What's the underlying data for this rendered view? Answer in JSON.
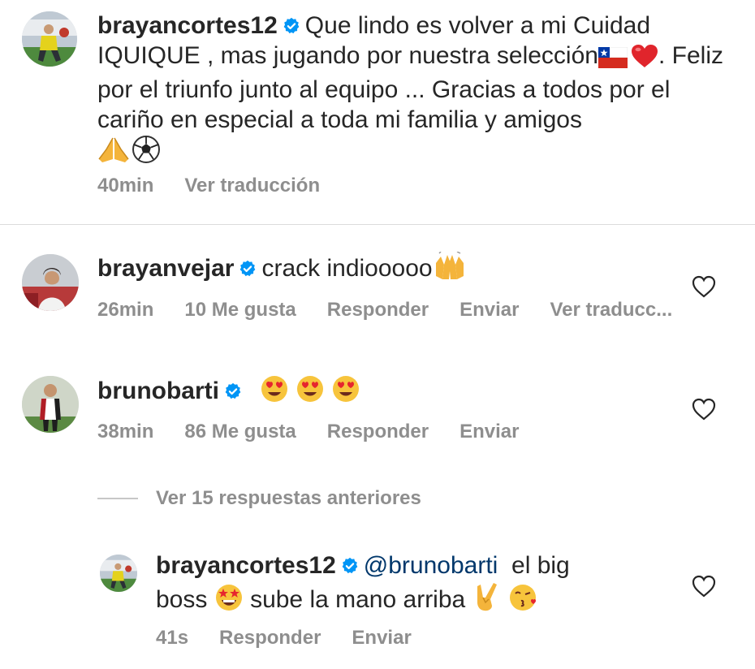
{
  "caption": {
    "username": "brayancortes12",
    "text": "Que lindo es volver a mi Cuidad IQUIQUE , mas jugando por nuestra selección",
    "text2": ". Feliz por el triunfo junto al equipo ... Gracias a todos por el cariño en especial a toda mi familia y amigos",
    "time": "40min",
    "translate": "Ver traducción"
  },
  "comments": [
    {
      "username": "brayanvejar",
      "text": "crack indiooooo",
      "time": "26min",
      "likes": "10 Me gusta",
      "reply": "Responder",
      "send": "Enviar",
      "translate": "Ver traducc..."
    },
    {
      "username": "brunobarti",
      "text": "",
      "time": "38min",
      "likes": "86 Me gusta",
      "reply": "Responder",
      "send": "Enviar"
    }
  ],
  "view_replies": "Ver 15 respuestas anteriores",
  "reply": {
    "username": "brayancortes12",
    "mention": "@brunobarti",
    "text1": "el big",
    "text2a": "boss",
    "text2b": "sube la mano arriba",
    "time": "41s",
    "reply": "Responder",
    "send": "Enviar"
  },
  "colors": {
    "text": "#262626",
    "meta": "#8e8e8e",
    "verified": "#0095f6",
    "mention": "#00376b"
  },
  "icons": [
    "verified-badge-icon",
    "heart-icon",
    "chile-flag-icon",
    "red-heart-icon",
    "praying-hands-icon",
    "soccer-ball-icon",
    "raising-hands-icon",
    "heart-eyes-icon",
    "star-struck-icon",
    "rock-on-hand-icon",
    "kiss-face-icon"
  ]
}
